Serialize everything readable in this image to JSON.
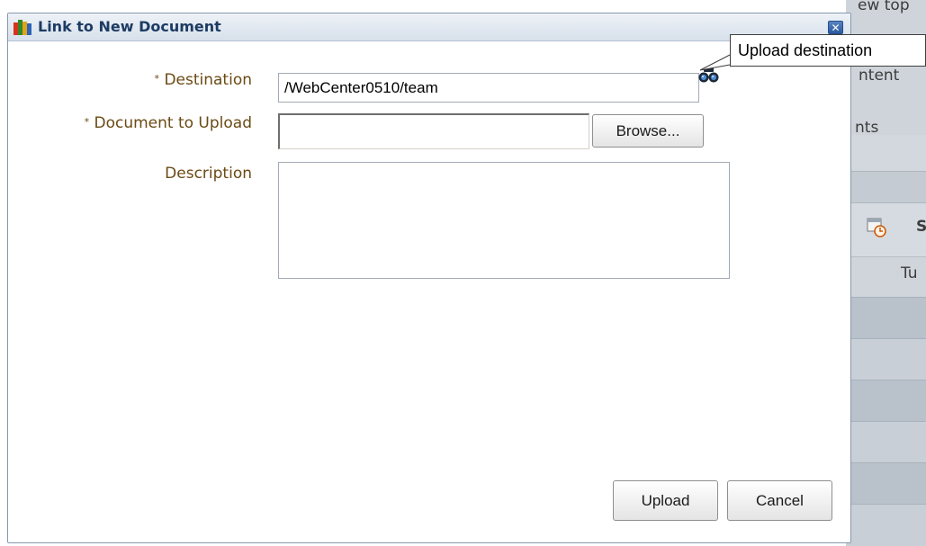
{
  "background": {
    "snippets": [
      "ew top",
      "ntent",
      "nts",
      "S",
      "Tu"
    ]
  },
  "dialog": {
    "title": "Link to New Document",
    "icon": "app-icon",
    "close_icon": "close-icon",
    "close_glyph": "✕"
  },
  "form": {
    "required_marker": "*",
    "destination": {
      "label": "Destination",
      "value": "/WebCenter0510/team",
      "icon": "binoculars-icon"
    },
    "document": {
      "label": "Document to Upload",
      "value": "",
      "browse_label": "Browse..."
    },
    "description": {
      "label": "Description",
      "value": ""
    }
  },
  "tooltip": {
    "text": "Upload destination"
  },
  "footer": {
    "upload_label": "Upload",
    "cancel_label": "Cancel"
  },
  "colors": {
    "label": "#6b4a14",
    "header_title": "#1d3c64",
    "background_app": "#c6ccd3"
  }
}
